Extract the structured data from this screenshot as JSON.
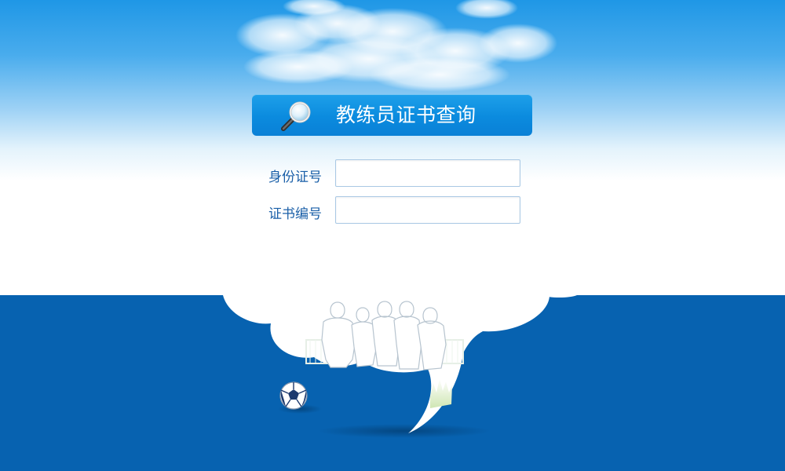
{
  "header": {
    "title": "教练员证书查询",
    "icon": "magnifier-icon"
  },
  "form": {
    "id_label": "身份证号",
    "id_value": "",
    "cert_label": "证书编号",
    "cert_value": ""
  },
  "colors": {
    "sky_top": "#1f97e6",
    "title_bar": "#0b8bde",
    "label_text": "#1a5fa8",
    "bottom_band": "#0762b0"
  }
}
